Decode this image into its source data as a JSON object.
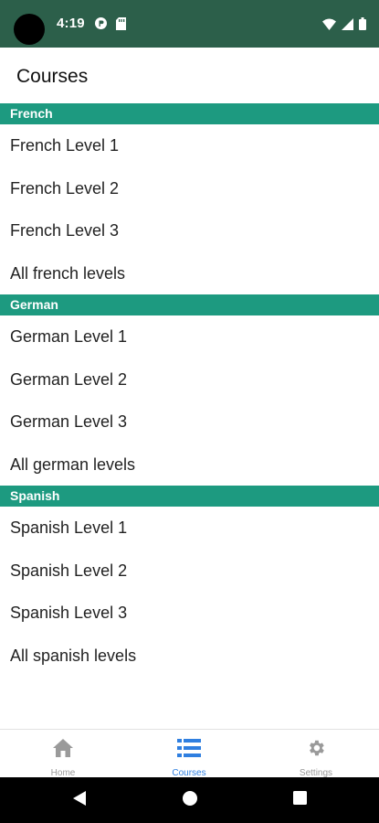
{
  "status_bar": {
    "time": "4:19",
    "icons": [
      "notification-icon",
      "sd-card-icon",
      "wifi-icon",
      "signal-icon",
      "battery-icon"
    ]
  },
  "app_bar": {
    "title": "Courses"
  },
  "sections": [
    {
      "header": "French",
      "items": [
        "French Level 1",
        "French Level 2",
        "French Level 3",
        "All french levels"
      ]
    },
    {
      "header": "German",
      "items": [
        "German Level 1",
        "German Level 2",
        "German Level 3",
        "All german levels"
      ]
    },
    {
      "header": "Spanish",
      "items": [
        "Spanish Level 1",
        "Spanish Level 2",
        "Spanish Level 3",
        "All spanish levels"
      ]
    }
  ],
  "bottom_nav": {
    "items": [
      {
        "label": "Home",
        "icon": "home-icon"
      },
      {
        "label": "Courses",
        "icon": "list-icon",
        "active": true
      },
      {
        "label": "Settings",
        "icon": "gear-icon"
      }
    ]
  },
  "colors": {
    "status_bar": "#2c5f4a",
    "section_header": "#1d9a80",
    "active_tab": "#2f7fe0",
    "inactive_tab": "#9a9a9a"
  }
}
